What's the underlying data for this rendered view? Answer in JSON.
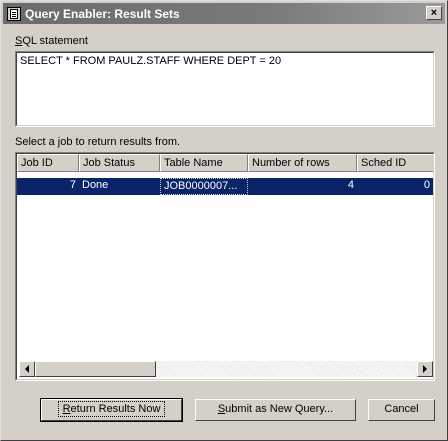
{
  "window": {
    "title": "Query Enabler: Result Sets",
    "close_label": "×"
  },
  "sql": {
    "label_prefix": "S",
    "label_rest": "QL statement",
    "statement": "SELECT * FROM PAULZ.STAFF WHERE DEPT = 20"
  },
  "jobs": {
    "label": "Select a job to return results from.",
    "columns": [
      "Job ID",
      "Job Status",
      "Table Name",
      "Number of rows",
      "Sched ID"
    ],
    "rows": [
      {
        "job_id": "7",
        "status": "Done",
        "table_name": "JOB0000007...",
        "rows": "4",
        "sched_id": "0"
      }
    ]
  },
  "buttons": {
    "return_prefix": "R",
    "return_rest": "eturn Results Now",
    "submit_prefix": "S",
    "submit_rest": "ubmit as New Query...",
    "cancel": "Cancel"
  },
  "colors": {
    "selection": "#0a246a",
    "face": "#d4d0c8",
    "title_gradient": "#6b6b6b"
  }
}
